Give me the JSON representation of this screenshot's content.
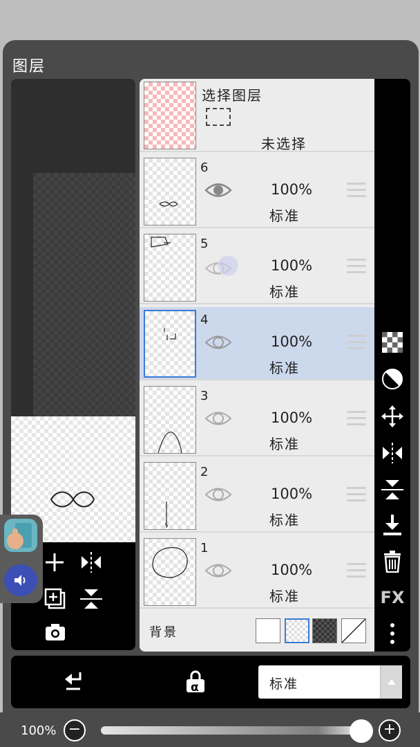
{
  "panel": {
    "title": "图层"
  },
  "selection": {
    "title": "选择图层",
    "status": "未选择"
  },
  "layers": [
    {
      "number": "6",
      "opacity": "100%",
      "mode": "标准",
      "visible": true,
      "active": false
    },
    {
      "number": "5",
      "opacity": "100%",
      "mode": "标准",
      "visible": true,
      "active": false
    },
    {
      "number": "4",
      "opacity": "100%",
      "mode": "标准",
      "visible": true,
      "active": true
    },
    {
      "number": "3",
      "opacity": "100%",
      "mode": "标准",
      "visible": true,
      "active": false
    },
    {
      "number": "2",
      "opacity": "100%",
      "mode": "标准",
      "visible": true,
      "active": false
    },
    {
      "number": "1",
      "opacity": "100%",
      "mode": "标准",
      "visible": true,
      "active": false
    }
  ],
  "background": {
    "label": "背景",
    "options": [
      "white",
      "transparent",
      "dark-checker",
      "none"
    ],
    "selected": "transparent"
  },
  "right_toolbar": [
    "checker-icon",
    "mask-icon",
    "move-icon",
    "flip-horizontal-icon",
    "flip-vertical-icon",
    "merge-down-icon",
    "trash-icon",
    "fx-icon",
    "more-icon"
  ],
  "fx_label": "FX",
  "left_tools": [
    "add-layer-icon",
    "flip-h-icon",
    "duplicate-layer-icon",
    "flip-v-icon",
    "camera-icon"
  ],
  "bottom": {
    "blend_mode": "标准",
    "alpha_lock_label": "α"
  },
  "opacity_bar": {
    "label": "100%",
    "value": 100,
    "minus": "−",
    "plus": "+"
  },
  "colors": {
    "active_row": "#ccd8ec",
    "accent": "#3a7bd5",
    "panel_bg": "#4a4a4a"
  }
}
